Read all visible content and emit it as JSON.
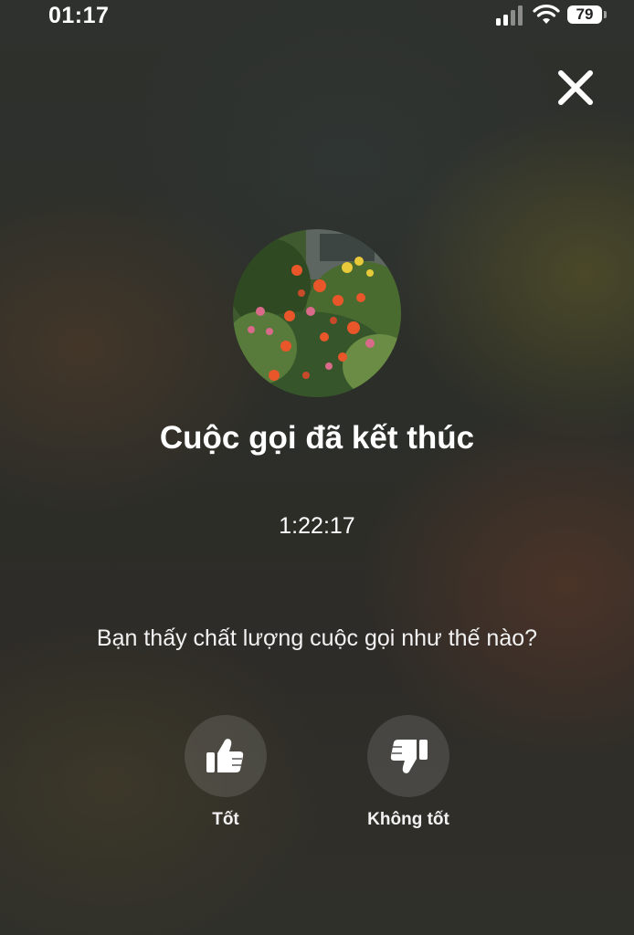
{
  "status_bar": {
    "time": "01:17",
    "battery": "79",
    "icons": [
      "cellular-signal-icon",
      "wifi-icon",
      "battery-icon"
    ]
  },
  "close_icon": "close-icon",
  "avatar": {
    "icon": "avatar-flowers-photo"
  },
  "call": {
    "title": "Cuộc gọi đã kết thúc",
    "duration": "1:22:17"
  },
  "feedback": {
    "question": "Bạn thấy chất lượng cuộc gọi như thế nào?",
    "good_label": "Tốt",
    "good_icon": "thumbs-up-icon",
    "bad_label": "Không tốt",
    "bad_icon": "thumbs-down-icon"
  },
  "colors": {
    "text": "#ffffff",
    "button_bg": "rgba(255,255,255,0.12)"
  }
}
